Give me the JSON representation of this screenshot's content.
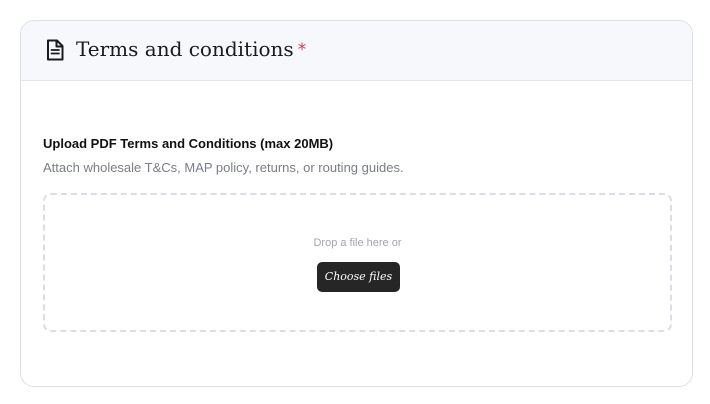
{
  "section": {
    "title": "Terms and conditions",
    "required_marker": "*",
    "icon": "document-icon"
  },
  "upload": {
    "label": "Upload PDF Terms and Conditions (max 20MB)",
    "help_text": "Attach wholesale T&Cs, MAP policy, returns, or routing guides.",
    "dropzone_text": "Drop a file here or",
    "button_label": "Choose files"
  },
  "colors": {
    "required": "#d6365b",
    "button_bg": "#262626",
    "header_bg": "#f7f8fc"
  }
}
